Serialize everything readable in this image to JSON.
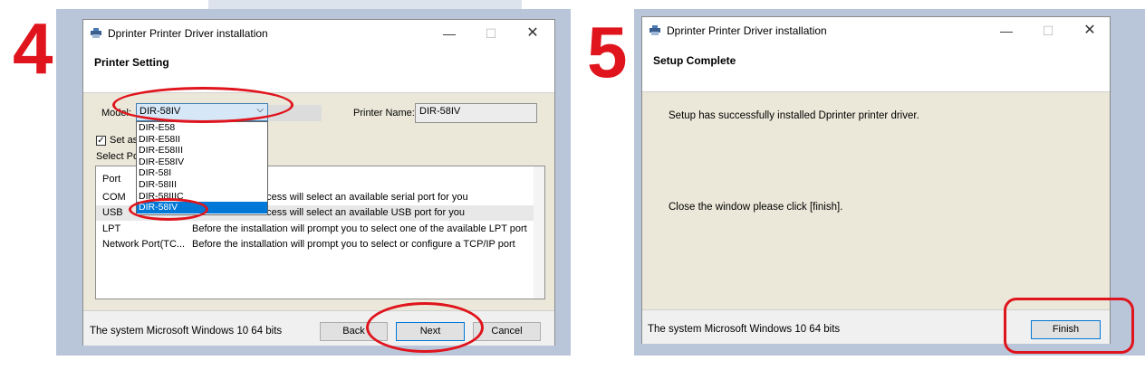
{
  "step4": {
    "number": "4",
    "window_title": "Dprinter Printer Driver installation",
    "header_title": "Printer Setting",
    "model_label": "Model:",
    "model_value": "DIR-58IV",
    "printer_name_label": "Printer Name:",
    "printer_name_value": "DIR-58IV",
    "set_default_label": "Set as",
    "set_default_checked": true,
    "select_port_label": "Select Po",
    "port_header": "Port",
    "dropdown_items": [
      "DIR-E58",
      "DIR-E58II",
      "DIR-E58III",
      "DIR-E58IV",
      "DIR-58I",
      "DIR-58III",
      "DIR-58IIIC",
      "DIR-58IV"
    ],
    "dropdown_selected_index": 7,
    "ports": [
      {
        "name": "COM",
        "desc": "ocess will select an available serial port for you"
      },
      {
        "name": "USB",
        "desc": "ocess will select an available USB port for you"
      },
      {
        "name": "LPT",
        "desc": "Before the installation will prompt you to select one of the available LPT port"
      },
      {
        "name": "Network Port(TC...",
        "desc": "Before the installation will prompt you to select or configure a TCP/IP port"
      }
    ],
    "status_text": "The system Microsoft Windows 10 64 bits",
    "back_label": "Back",
    "next_label": "Next",
    "cancel_label": "Cancel"
  },
  "step5": {
    "number": "5",
    "window_title": "Dprinter Printer Driver installation",
    "header_title": "Setup Complete",
    "message1": "Setup has successfully installed Dprinter printer driver.",
    "message2": "Close the window please click [finish].",
    "status_text": "The system Microsoft Windows 10 64 bits",
    "finish_label": "Finish"
  },
  "icons": {
    "app": "printer-icon",
    "minimize": "minimize-icon",
    "maximize": "maximize-icon",
    "close": "close-icon",
    "chevron": "chevron-down-icon",
    "check": "check-icon"
  },
  "colors": {
    "highlight": "#e0141c",
    "selection": "#0078d7",
    "body_bg": "#ebe8d9",
    "panel_bg": "#b9c6da"
  }
}
